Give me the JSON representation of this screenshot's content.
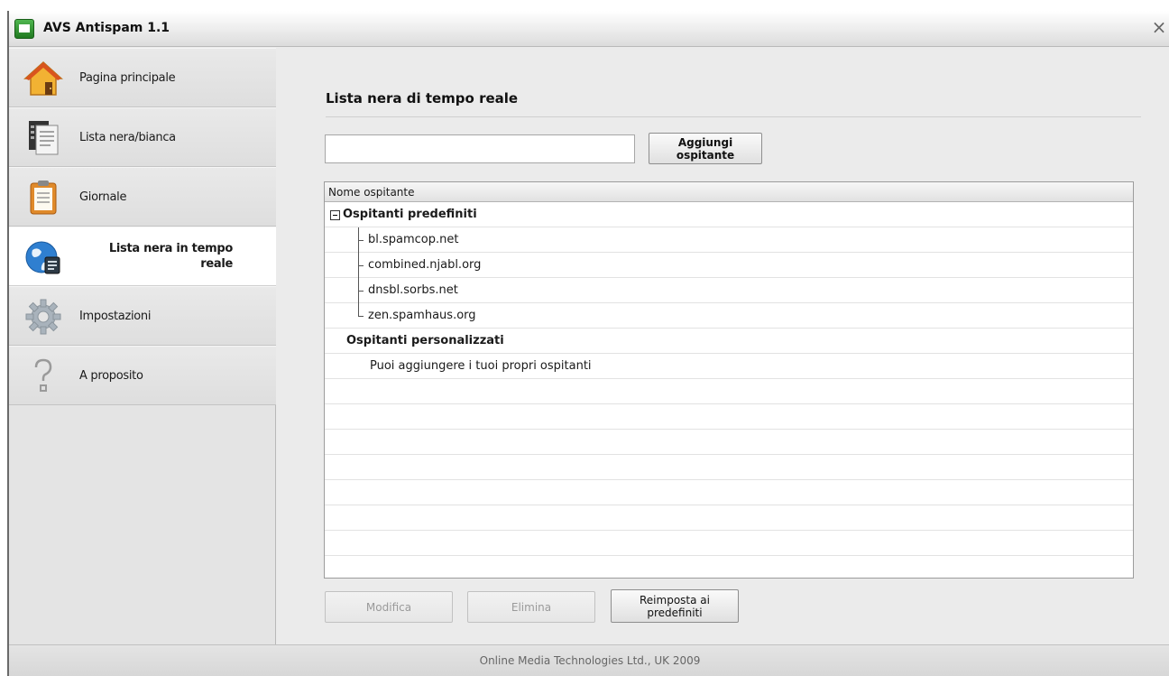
{
  "window": {
    "title": "AVS Antispam 1.1",
    "close_glyph": "×"
  },
  "sidebar": {
    "items": [
      {
        "label": "Pagina principale",
        "icon": "home-icon"
      },
      {
        "label": "Lista nera/bianca",
        "icon": "document-list-icon"
      },
      {
        "label": "Giornale",
        "icon": "clipboard-icon"
      },
      {
        "label": "Lista nera in tempo reale",
        "icon": "globe-icon",
        "active": true
      },
      {
        "label": "Impostazioni",
        "icon": "gear-icon"
      },
      {
        "label": "A proposito",
        "icon": "question-icon"
      }
    ]
  },
  "main": {
    "heading": "Lista nera di tempo reale",
    "host_input": {
      "value": "",
      "placeholder": ""
    },
    "add_button": "Aggiungi ospitante",
    "list": {
      "column_header": "Nome ospitante",
      "groups": [
        {
          "label": "Ospitanti predefiniti",
          "expanded": true,
          "items": [
            "bl.spamcop.net",
            "combined.njabl.org",
            "dnsbl.sorbs.net",
            "zen.spamhaus.org"
          ]
        },
        {
          "label": "Ospitanti personalizzati",
          "items": [
            "Puoi aggiungere i tuoi propri ospitanti"
          ]
        }
      ]
    },
    "buttons": {
      "edit": "Modifica",
      "delete": "Elimina",
      "reset": "Reimposta ai predefiniti"
    }
  },
  "footer": {
    "text": "Online Media Technologies Ltd., UK 2009"
  },
  "colors": {
    "sidebar_bg": "#e4e4e4",
    "main_bg": "#ebebeb",
    "active_item_bg": "#ffffff",
    "disabled_text": "#9a9a9a"
  }
}
